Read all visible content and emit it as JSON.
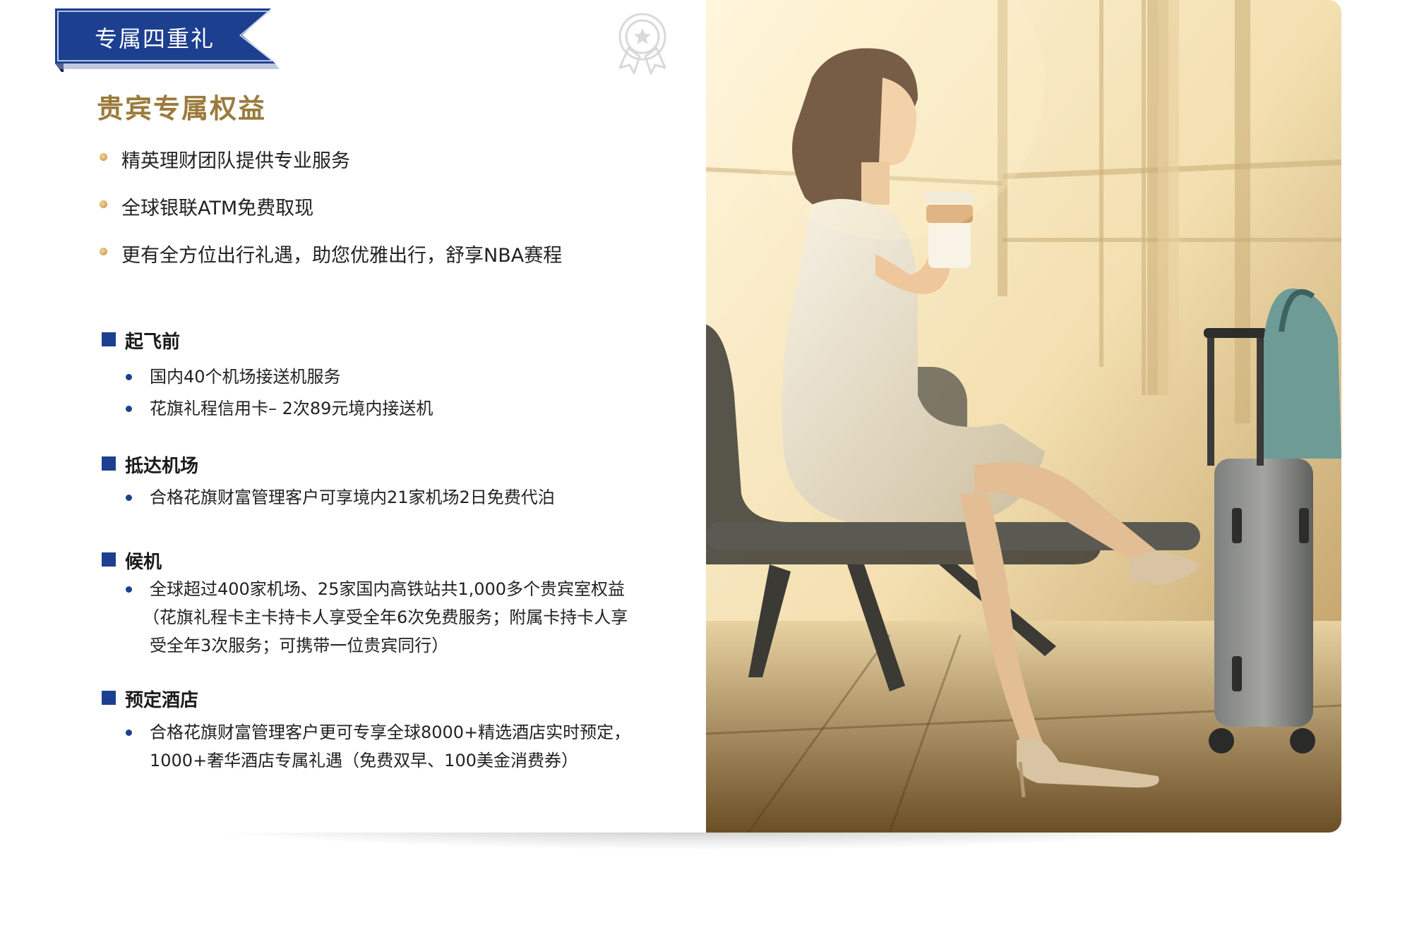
{
  "ribbon": {
    "label": "专属四重礼"
  },
  "icons": {
    "award": "award-badge-icon"
  },
  "section": {
    "title": "贵宾专属权益"
  },
  "benefits": [
    "精英理财团队提供专业服务",
    "全球银联ATM免费取现",
    "更有全方位出行礼遇，助您优雅出行，舒享NBA赛程"
  ],
  "categories": [
    {
      "title": "起飞前",
      "items": [
        [
          "国内40个机场接送机服务"
        ],
        [
          "花旗礼程信用卡– 2次89元境内接送机"
        ]
      ]
    },
    {
      "title": "抵达机场",
      "items": [
        [
          "合格花旗财富管理客户可享境内21家机场2日免费代泊"
        ]
      ]
    },
    {
      "title": "候机",
      "items": [
        [
          "全球超过400家机场、25家国内高铁站共1,000多个贵宾室权益",
          "（花旗礼程卡主卡持卡人享受全年6次免费服务；附属卡持卡人享",
          "受全年3次服务；可携带一位贵宾同行）"
        ]
      ]
    },
    {
      "title": "预定酒店",
      "items": [
        [
          "合格花旗财富管理客户更可专享全球8000+精选酒店实时预定，",
          "1000+奢华酒店专属礼遇（免费双早、100美金消费券）"
        ]
      ]
    }
  ],
  "colors": {
    "navy": "#1d3f8f",
    "gold": "#9a7b3c",
    "text": "#222222"
  }
}
